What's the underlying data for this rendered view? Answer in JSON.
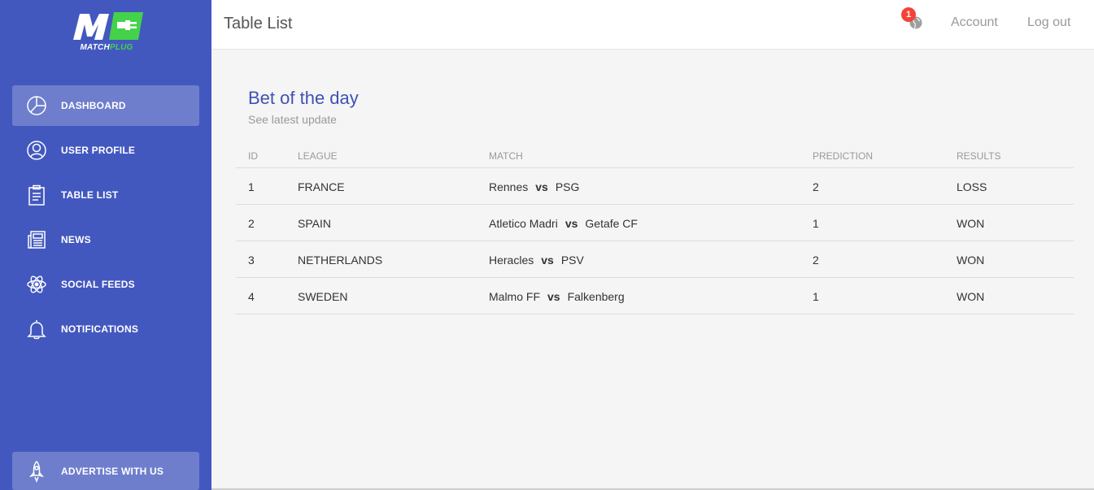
{
  "brand": {
    "logo_mark": "M",
    "logo_prefix": "MATCH",
    "logo_suffix": "PLUG",
    "colors": {
      "sidebar": "#4358bf",
      "accent_green": "#44d24a",
      "title_blue": "#3f51b5",
      "badge_red": "#f44336"
    }
  },
  "sidebar": {
    "items": [
      {
        "label": "DASHBOARD",
        "icon": "pie-chart-icon",
        "active": true
      },
      {
        "label": "USER PROFILE",
        "icon": "user-icon",
        "active": false
      },
      {
        "label": "TABLE LIST",
        "icon": "clipboard-icon",
        "active": false
      },
      {
        "label": "NEWS",
        "icon": "newspaper-icon",
        "active": false
      },
      {
        "label": "SOCIAL FEEDS",
        "icon": "atom-icon",
        "active": false
      },
      {
        "label": "NOTIFICATIONS",
        "icon": "bell-icon",
        "active": false
      }
    ],
    "bottom_item": {
      "label": "ADVERTISE WITH US",
      "icon": "rocket-icon"
    }
  },
  "header": {
    "title": "Table List",
    "notification_count": "1",
    "account_label": "Account",
    "logout_label": "Log out"
  },
  "card": {
    "title": "Bet of the day",
    "subtitle": "See latest update",
    "columns": [
      "ID",
      "LEAGUE",
      "MATCH",
      "PREDICTION",
      "RESULTS"
    ],
    "rows": [
      {
        "id": "1",
        "league": "FRANCE",
        "home": "Rennes",
        "vs": "vs",
        "away": "PSG",
        "prediction": "2",
        "result": "LOSS"
      },
      {
        "id": "2",
        "league": "SPAIN",
        "home": "Atletico Madri",
        "vs": "vs",
        "away": "Getafe CF",
        "prediction": "1",
        "result": "WON"
      },
      {
        "id": "3",
        "league": "NETHERLANDS",
        "home": "Heracles",
        "vs": "vs",
        "away": "PSV",
        "prediction": "2",
        "result": "WON"
      },
      {
        "id": "4",
        "league": "SWEDEN",
        "home": "Malmo FF",
        "vs": "vs",
        "away": "Falkenberg",
        "prediction": "1",
        "result": "WON"
      }
    ]
  }
}
